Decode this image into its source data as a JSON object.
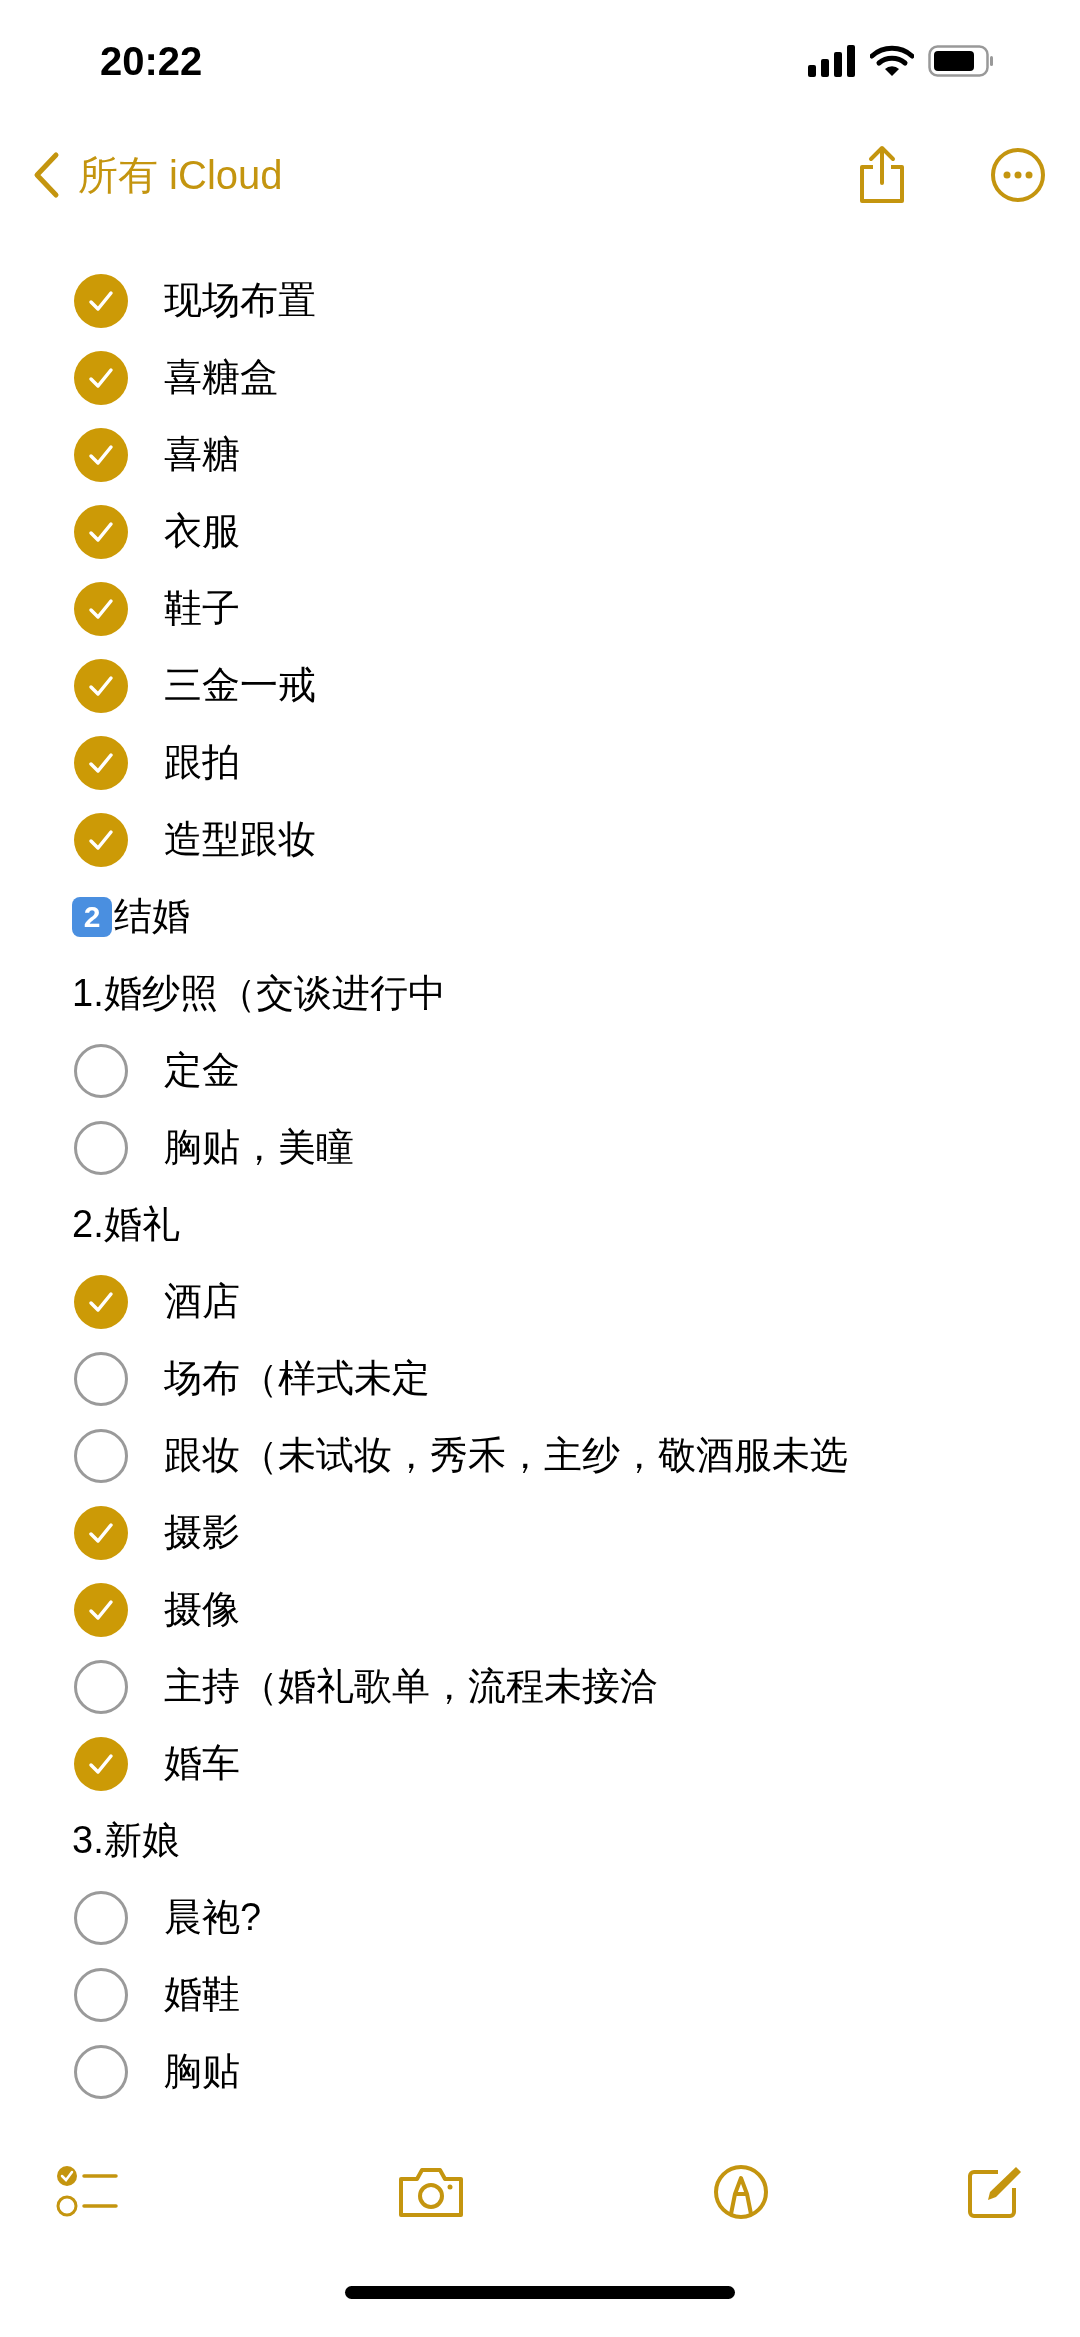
{
  "status_bar": {
    "time": "20:22"
  },
  "nav": {
    "back_label": "所有 iCloud"
  },
  "lines": [
    {
      "kind": "check",
      "text": "现场布置",
      "checked": true
    },
    {
      "kind": "check",
      "text": "喜糖盒",
      "checked": true
    },
    {
      "kind": "check",
      "text": "喜糖",
      "checked": true
    },
    {
      "kind": "check",
      "text": "衣服",
      "checked": true
    },
    {
      "kind": "check",
      "text": "鞋子",
      "checked": true
    },
    {
      "kind": "check",
      "text": "三金一戒",
      "checked": true
    },
    {
      "kind": "check",
      "text": "跟拍",
      "checked": true
    },
    {
      "kind": "check",
      "text": "造型跟妆",
      "checked": true
    },
    {
      "kind": "keycap_heading",
      "keycap": "2",
      "text": "结婚"
    },
    {
      "kind": "heading",
      "text": "1.婚纱照（交谈进行中"
    },
    {
      "kind": "check",
      "text": "定金",
      "checked": false
    },
    {
      "kind": "check",
      "text": "胸贴，美瞳",
      "checked": false
    },
    {
      "kind": "heading",
      "text": "2.婚礼"
    },
    {
      "kind": "check",
      "text": "酒店",
      "checked": true
    },
    {
      "kind": "check",
      "text": "场布（样式未定",
      "checked": false
    },
    {
      "kind": "check",
      "text": "跟妆（未试妆，秀禾，主纱，敬酒服未选",
      "checked": false
    },
    {
      "kind": "check",
      "text": "摄影",
      "checked": true
    },
    {
      "kind": "check",
      "text": "摄像",
      "checked": true
    },
    {
      "kind": "check",
      "text": "主持（婚礼歌单，流程未接洽",
      "checked": false
    },
    {
      "kind": "check",
      "text": "婚车",
      "checked": true
    },
    {
      "kind": "heading",
      "text": "3.新娘"
    },
    {
      "kind": "check",
      "text": "晨袍?",
      "checked": false
    },
    {
      "kind": "check",
      "text": "婚鞋",
      "checked": false
    },
    {
      "kind": "check",
      "text": "胸贴",
      "checked": false
    }
  ]
}
